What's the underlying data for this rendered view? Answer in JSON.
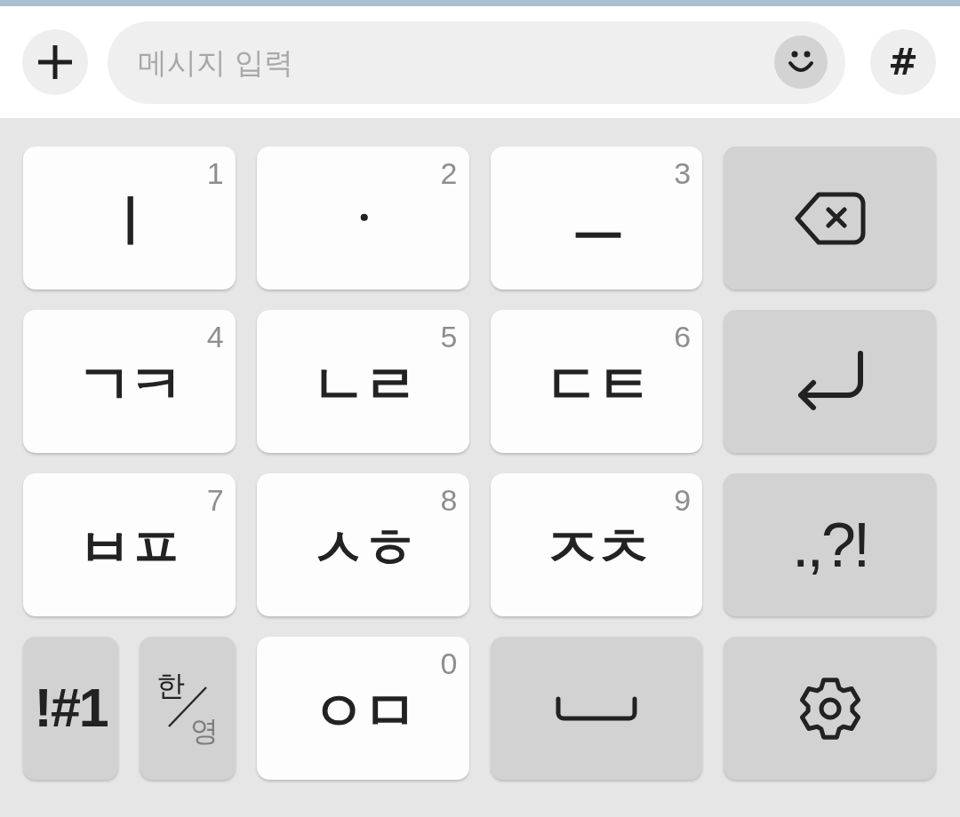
{
  "composer": {
    "input": {
      "placeholder": "메시지 입력"
    },
    "tag_button": {
      "label": "#"
    }
  },
  "keyboard": {
    "rows": [
      {
        "keys": [
          {
            "kind": "char",
            "label": "ㅣ",
            "number": "1"
          },
          {
            "kind": "char",
            "label": "ㆍ",
            "number": "2"
          },
          {
            "kind": "char",
            "label": "ㅡ",
            "number": "3"
          },
          {
            "kind": "backspace"
          }
        ]
      },
      {
        "keys": [
          {
            "kind": "char",
            "label": "ㄱㅋ",
            "number": "4"
          },
          {
            "kind": "char",
            "label": "ㄴㄹ",
            "number": "5"
          },
          {
            "kind": "char",
            "label": "ㄷㅌ",
            "number": "6"
          },
          {
            "kind": "enter"
          }
        ]
      },
      {
        "keys": [
          {
            "kind": "char",
            "label": "ㅂㅍ",
            "number": "7"
          },
          {
            "kind": "char",
            "label": "ㅅㅎ",
            "number": "8"
          },
          {
            "kind": "char",
            "label": "ㅈㅊ",
            "number": "9"
          },
          {
            "kind": "punctuation",
            "label": ".,?!"
          }
        ]
      },
      {
        "keys": [
          {
            "kind": "symbols",
            "label": "!#1"
          },
          {
            "kind": "language",
            "options": [
              {
                "label": "한",
                "selected": true
              },
              {
                "label": "영",
                "selected": false
              }
            ]
          },
          {
            "kind": "char",
            "label": "ㅇㅁ",
            "number": "0"
          },
          {
            "kind": "space"
          },
          {
            "kind": "settings"
          }
        ]
      }
    ]
  }
}
